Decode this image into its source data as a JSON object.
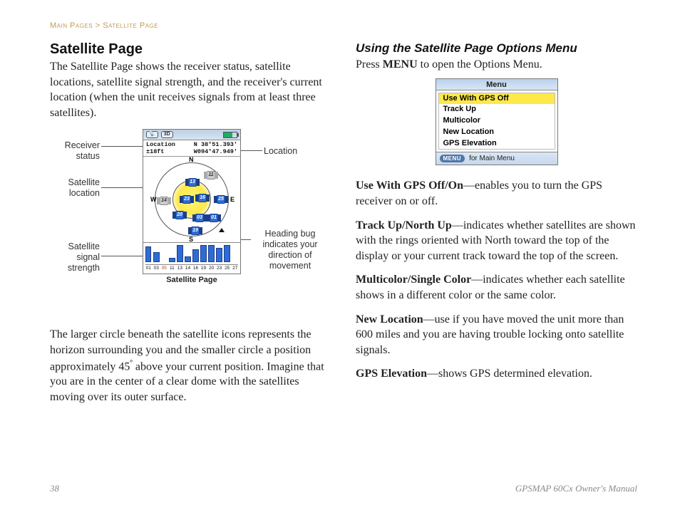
{
  "breadcrumb": {
    "a": "Main Pages",
    "sep": ">",
    "b": "Satellite Page"
  },
  "left": {
    "title": "Satellite Page",
    "intro": "The Satellite Page shows the receiver status, satellite locations, satellite signal strength, and the receiver's current location (when the unit receives signals from at least three satellites).",
    "annot": {
      "receiver": "Receiver status",
      "sat_loc": "Satellite location",
      "sig": "Satellite signal strength",
      "location": "Location",
      "heading": "Heading bug indicates your direction of movement"
    },
    "device": {
      "status3d": "3D",
      "loc_label": "Location",
      "loc_acc": "±18ft",
      "lat": "N 38°51.393'",
      "lon": "W094°47.949'",
      "cardinals": {
        "n": "N",
        "e": "E",
        "s": "S",
        "w": "W"
      },
      "sats": [
        "13",
        "11",
        "23",
        "16",
        "25",
        "20",
        "03",
        "01",
        "19"
      ]
    },
    "caption": "Satellite Page",
    "para2_a": "The larger circle beneath the satellite icons represents the horizon surrounding you and the smaller circle a position approximately 45",
    "para2_deg": "º",
    "para2_b": " above your current position. Imagine that you are in the center of a clear dome with the satellites moving over its outer surface."
  },
  "right": {
    "title": "Using the Satellite Page Options Menu",
    "press_a": "Press ",
    "press_b": "MENU",
    "press_c": " to open the Options Menu.",
    "menu": {
      "title": "Menu",
      "items": [
        "Use With GPS Off",
        "Track Up",
        "Multicolor",
        "New Location",
        "GPS Elevation"
      ],
      "key": "MENU",
      "footer_rest": " for Main Menu"
    },
    "opt_gps_b": "Use With GPS Off/On",
    "opt_gps_t": "—enables you to turn the GPS receiver on or off.",
    "opt_track_b": "Track Up/North Up",
    "opt_track_t": "—indicates whether satellites are shown with the rings oriented with North toward the top of the display or your current track toward the top of the screen.",
    "opt_color_b": "Multicolor/Single Color",
    "opt_color_t": "—indicates whether each satellite shows in a different color or the same color.",
    "opt_newloc_b": "New Location",
    "opt_newloc_t": "—use if you have moved the unit more than 600 miles and you are having trouble locking onto satellite signals.",
    "opt_elev_b": "GPS Elevation",
    "opt_elev_t": "—shows GPS determined elevation."
  },
  "footer": {
    "page": "38",
    "manual": "GPSMAP 60Cx Owner's Manual"
  },
  "chart_data": {
    "type": "bar",
    "title": "Satellite signal strength",
    "categories": [
      "01",
      "03",
      "05",
      "11",
      "13",
      "14",
      "16",
      "19",
      "20",
      "23",
      "25",
      "27"
    ],
    "values": [
      22,
      14,
      0,
      6,
      24,
      8,
      18,
      24,
      24,
      20,
      24,
      0
    ],
    "ylim": [
      0,
      26
    ],
    "notes": {
      "empty_prns": [
        "05",
        "27"
      ],
      "red_label_prns": [
        "05"
      ]
    }
  }
}
